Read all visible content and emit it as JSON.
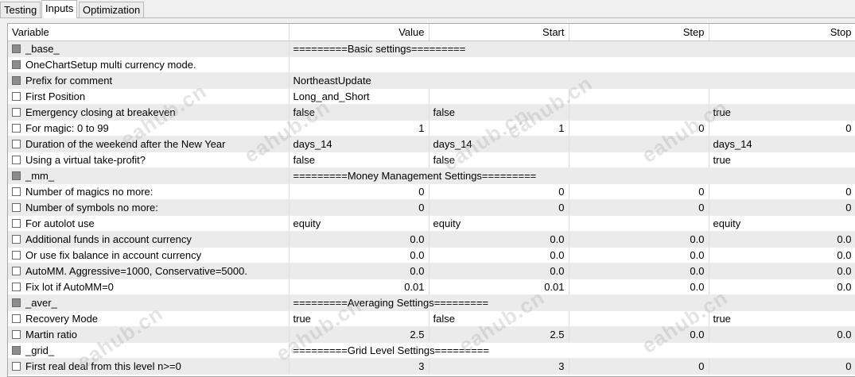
{
  "tabs": [
    "Testing",
    "Inputs",
    "Optimization"
  ],
  "columns": [
    "Variable",
    "Value",
    "Start",
    "Step",
    "Stop"
  ],
  "watermark": "eahub.cn",
  "rows": [
    {
      "type": "section",
      "variable": "_base_",
      "value": "=========Basic settings========="
    },
    {
      "type": "section",
      "variable": "OneChartSetup multi currency mode.",
      "value": ""
    },
    {
      "type": "section",
      "variable": "Prefix for comment",
      "value": "NortheastUpdate"
    },
    {
      "type": "param",
      "variable": "First Position",
      "value": "Long_and_Short",
      "start": "",
      "step": "",
      "stop": "",
      "numeric": false
    },
    {
      "type": "param",
      "variable": "Emergency closing at breakeven",
      "value": "false",
      "start": "false",
      "step": "",
      "stop": "true",
      "numeric": false
    },
    {
      "type": "param",
      "variable": "For magic: 0 to 99",
      "value": "1",
      "start": "1",
      "step": "0",
      "stop": "0",
      "numeric": true
    },
    {
      "type": "param",
      "variable": "Duration of the weekend after the New Year",
      "value": "days_14",
      "start": "days_14",
      "step": "",
      "stop": "days_14",
      "numeric": false
    },
    {
      "type": "param",
      "variable": "Using a virtual take-profit?",
      "value": "false",
      "start": "false",
      "step": "",
      "stop": "true",
      "numeric": false
    },
    {
      "type": "section",
      "variable": "_mm_",
      "value": "=========Money Management Settings========="
    },
    {
      "type": "param",
      "variable": "Number of magics no more:",
      "value": "0",
      "start": "0",
      "step": "0",
      "stop": "0",
      "numeric": true
    },
    {
      "type": "param",
      "variable": "Number of symbols no more:",
      "value": "0",
      "start": "0",
      "step": "0",
      "stop": "0",
      "numeric": true
    },
    {
      "type": "param",
      "variable": "For autolot use",
      "value": "equity",
      "start": "equity",
      "step": "",
      "stop": "equity",
      "numeric": false
    },
    {
      "type": "param",
      "variable": "Additional funds in account currency",
      "value": "0.0",
      "start": "0.0",
      "step": "0.0",
      "stop": "0.0",
      "numeric": true
    },
    {
      "type": "param",
      "variable": "Or use fix balance in account currency",
      "value": "0.0",
      "start": "0.0",
      "step": "0.0",
      "stop": "0.0",
      "numeric": true
    },
    {
      "type": "param",
      "variable": "AutoMM. Aggressive=1000, Conservative=5000.",
      "value": "0.0",
      "start": "0.0",
      "step": "0.0",
      "stop": "0.0",
      "numeric": true
    },
    {
      "type": "param",
      "variable": "Fix lot if AutoMM=0",
      "value": "0.01",
      "start": "0.01",
      "step": "0.0",
      "stop": "0.0",
      "numeric": true
    },
    {
      "type": "section",
      "variable": "_aver_",
      "value": "=========Averaging Settings========="
    },
    {
      "type": "param",
      "variable": "Recovery Mode",
      "value": "true",
      "start": "false",
      "step": "",
      "stop": "true",
      "numeric": false
    },
    {
      "type": "param",
      "variable": "Martin ratio",
      "value": "2.5",
      "start": "2.5",
      "step": "0.0",
      "stop": "0.0",
      "numeric": true
    },
    {
      "type": "section",
      "variable": "_grid_",
      "value": "=========Grid Level Settings========="
    },
    {
      "type": "param",
      "variable": "First real deal from this level n>=0",
      "value": "3",
      "start": "3",
      "step": "0",
      "stop": "0",
      "numeric": true
    }
  ]
}
